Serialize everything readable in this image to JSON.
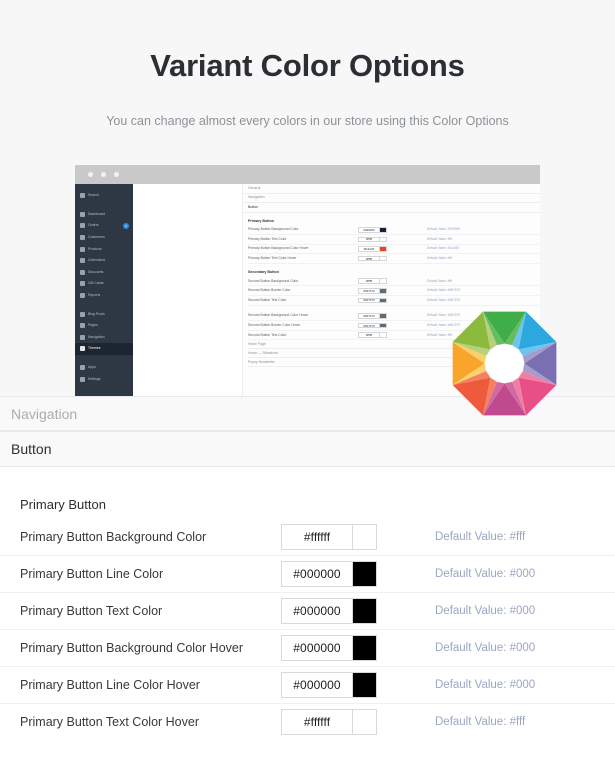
{
  "hero": {
    "title": "Variant Color Options",
    "subtitle": "You can change almost every colors in our store using this Color Options"
  },
  "mock": {
    "sidebar": {
      "items": [
        {
          "label": "Search",
          "icon": "search-icon",
          "active": false,
          "badge": ""
        },
        {
          "label": "Dashboard",
          "icon": "home-icon",
          "active": false,
          "badge": ""
        },
        {
          "label": "Orders",
          "icon": "cart-icon",
          "active": false,
          "badge": "3"
        },
        {
          "label": "Customers",
          "icon": "users-icon",
          "active": false,
          "badge": ""
        },
        {
          "label": "Products",
          "icon": "tag-icon",
          "active": false,
          "badge": ""
        },
        {
          "label": "Collections",
          "icon": "grid-icon",
          "active": false,
          "badge": ""
        },
        {
          "label": "Discounts",
          "icon": "percent-icon",
          "active": false,
          "badge": ""
        },
        {
          "label": "Gift Cards",
          "icon": "gift-icon",
          "active": false,
          "badge": ""
        },
        {
          "label": "Reports",
          "icon": "chart-icon",
          "active": false,
          "badge": ""
        },
        {
          "label": "Blog Posts",
          "icon": "post-icon",
          "active": false,
          "badge": ""
        },
        {
          "label": "Pages",
          "icon": "page-icon",
          "active": false,
          "badge": ""
        },
        {
          "label": "Navigation",
          "icon": "link-icon",
          "active": false,
          "badge": ""
        },
        {
          "label": "Themes",
          "icon": "image-icon",
          "active": true,
          "badge": ""
        },
        {
          "label": "Apps",
          "icon": "apps-icon",
          "active": false,
          "badge": ""
        },
        {
          "label": "Settings",
          "icon": "gear-icon",
          "active": false,
          "badge": ""
        }
      ]
    },
    "panel": {
      "sections": [
        {
          "label": "General",
          "dark": false
        },
        {
          "label": "Navigation",
          "dark": false
        },
        {
          "label": "Button",
          "dark": true
        }
      ],
      "groups": [
        {
          "title": "Primary Button",
          "rows": [
            {
              "label": "Primary Button Background Color",
              "value": "#090909",
              "swatch": "#17203a",
              "default": "Default Value: #090909"
            },
            {
              "label": "Primary Button Text Color",
              "value": "#ffffff",
              "swatch": "#ffffff",
              "default": "Default Value: #fff"
            },
            {
              "label": "Primary Button Background Color Hover",
              "value": "#f14d30",
              "swatch": "#ec4425",
              "default": "Default Value: #f14d30"
            },
            {
              "label": "Primary Button Text Color Hover",
              "value": "#ffffff",
              "swatch": "#ffffff",
              "default": "Default Value: #fff"
            }
          ]
        },
        {
          "title": "Secondary Button",
          "rows": [
            {
              "label": "Second Button Background Color",
              "value": "#ffffff",
              "swatch": "#ffffff",
              "default": "Default Value: #fff"
            },
            {
              "label": "Second Button Border Color",
              "value": "#667679",
              "swatch": "#5e6d73",
              "default": "Default Value: #667679"
            },
            {
              "label": "Second Button Text Color",
              "value": "#667679",
              "swatch": "#5e6d73",
              "default": "Default Value: #667679"
            },
            {
              "label": "Second Button Background Color Hover",
              "value": "#667679",
              "swatch": "#5e6d73",
              "default": "Default Value: #667679"
            },
            {
              "label": "Second Button Border Color Hover",
              "value": "#667679",
              "swatch": "#5e6d73",
              "default": "Default Value: #667679"
            },
            {
              "label": "Second Button Text Color",
              "value": "#ffffff",
              "swatch": "#ffffff",
              "default": "Default Value: #fff"
            }
          ]
        }
      ],
      "footer_items": [
        {
          "label": "Home Page"
        },
        {
          "label": "Home — Slideshow"
        },
        {
          "label": "Popup Newsletter"
        }
      ]
    }
  },
  "sections": {
    "navigation_label": "Navigation",
    "button_label": "Button"
  },
  "form": {
    "group_title": "Primary Button",
    "rows": [
      {
        "label": "Primary Button Background Color",
        "value": "#ffffff",
        "swatch": "#ffffff",
        "default": "Default Value: #fff"
      },
      {
        "label": "Primary Button Line Color",
        "value": "#000000",
        "swatch": "#000000",
        "default": "Default Value: #000"
      },
      {
        "label": "Primary Button Text Color",
        "value": "#000000",
        "swatch": "#000000",
        "default": "Default Value: #000"
      },
      {
        "label": "Primary Button Background Color Hover",
        "value": "#000000",
        "swatch": "#000000",
        "default": "Default Value: #000"
      },
      {
        "label": "Primary Button Line Color Hover",
        "value": "#000000",
        "swatch": "#000000",
        "default": "Default Value: #000"
      },
      {
        "label": "Primary Button Text Color Hover",
        "value": "#ffffff",
        "swatch": "#ffffff",
        "default": "Default Value: #fff"
      }
    ]
  },
  "wheel": {
    "name": "color-wheel-logo",
    "segments": [
      {
        "a": "#3fae49",
        "b": "#66bd5e"
      },
      {
        "a": "#2ba8e0",
        "b": "#6cc5ef"
      },
      {
        "a": "#7b6fb4",
        "b": "#a59ccb"
      },
      {
        "a": "#e94f87",
        "b": "#f07fa6"
      },
      {
        "a": "#c04a8e",
        "b": "#d06aa0"
      },
      {
        "a": "#f05a3c",
        "b": "#f58060"
      },
      {
        "a": "#f7a52b",
        "b": "#fbcf6a"
      },
      {
        "a": "#8cba3f",
        "b": "#b6d17a"
      }
    ]
  }
}
